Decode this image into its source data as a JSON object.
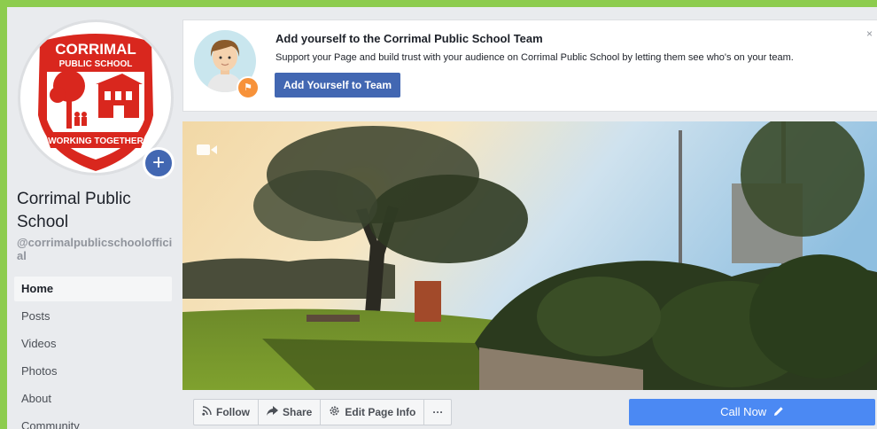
{
  "page": {
    "name": "Corrimal Public School",
    "handle": "@corrimalpublicschoolofficial"
  },
  "logo": {
    "top_text": "CORRIMAL",
    "sub_text": "PUBLIC SCHOOL",
    "ribbon_text": "WORKING TOGETHER",
    "color": "#d9271e"
  },
  "nav": {
    "items": [
      {
        "label": "Home",
        "active": true
      },
      {
        "label": "Posts"
      },
      {
        "label": "Videos"
      },
      {
        "label": "Photos"
      },
      {
        "label": "About"
      },
      {
        "label": "Community"
      }
    ]
  },
  "banner": {
    "title": "Add yourself to the Corrimal Public School Team",
    "text": "Support your Page and build trust with your audience on Corrimal Public School by letting them see who's on your team.",
    "button": "Add Yourself to Team",
    "close": "×"
  },
  "actions": {
    "follow": "Follow",
    "share": "Share",
    "edit": "Edit Page Info",
    "more": "···"
  },
  "cta": {
    "label": "Call Now"
  },
  "colors": {
    "accent": "#4267b2",
    "cta": "#4b89f3",
    "frame": "#8dcc4e"
  }
}
